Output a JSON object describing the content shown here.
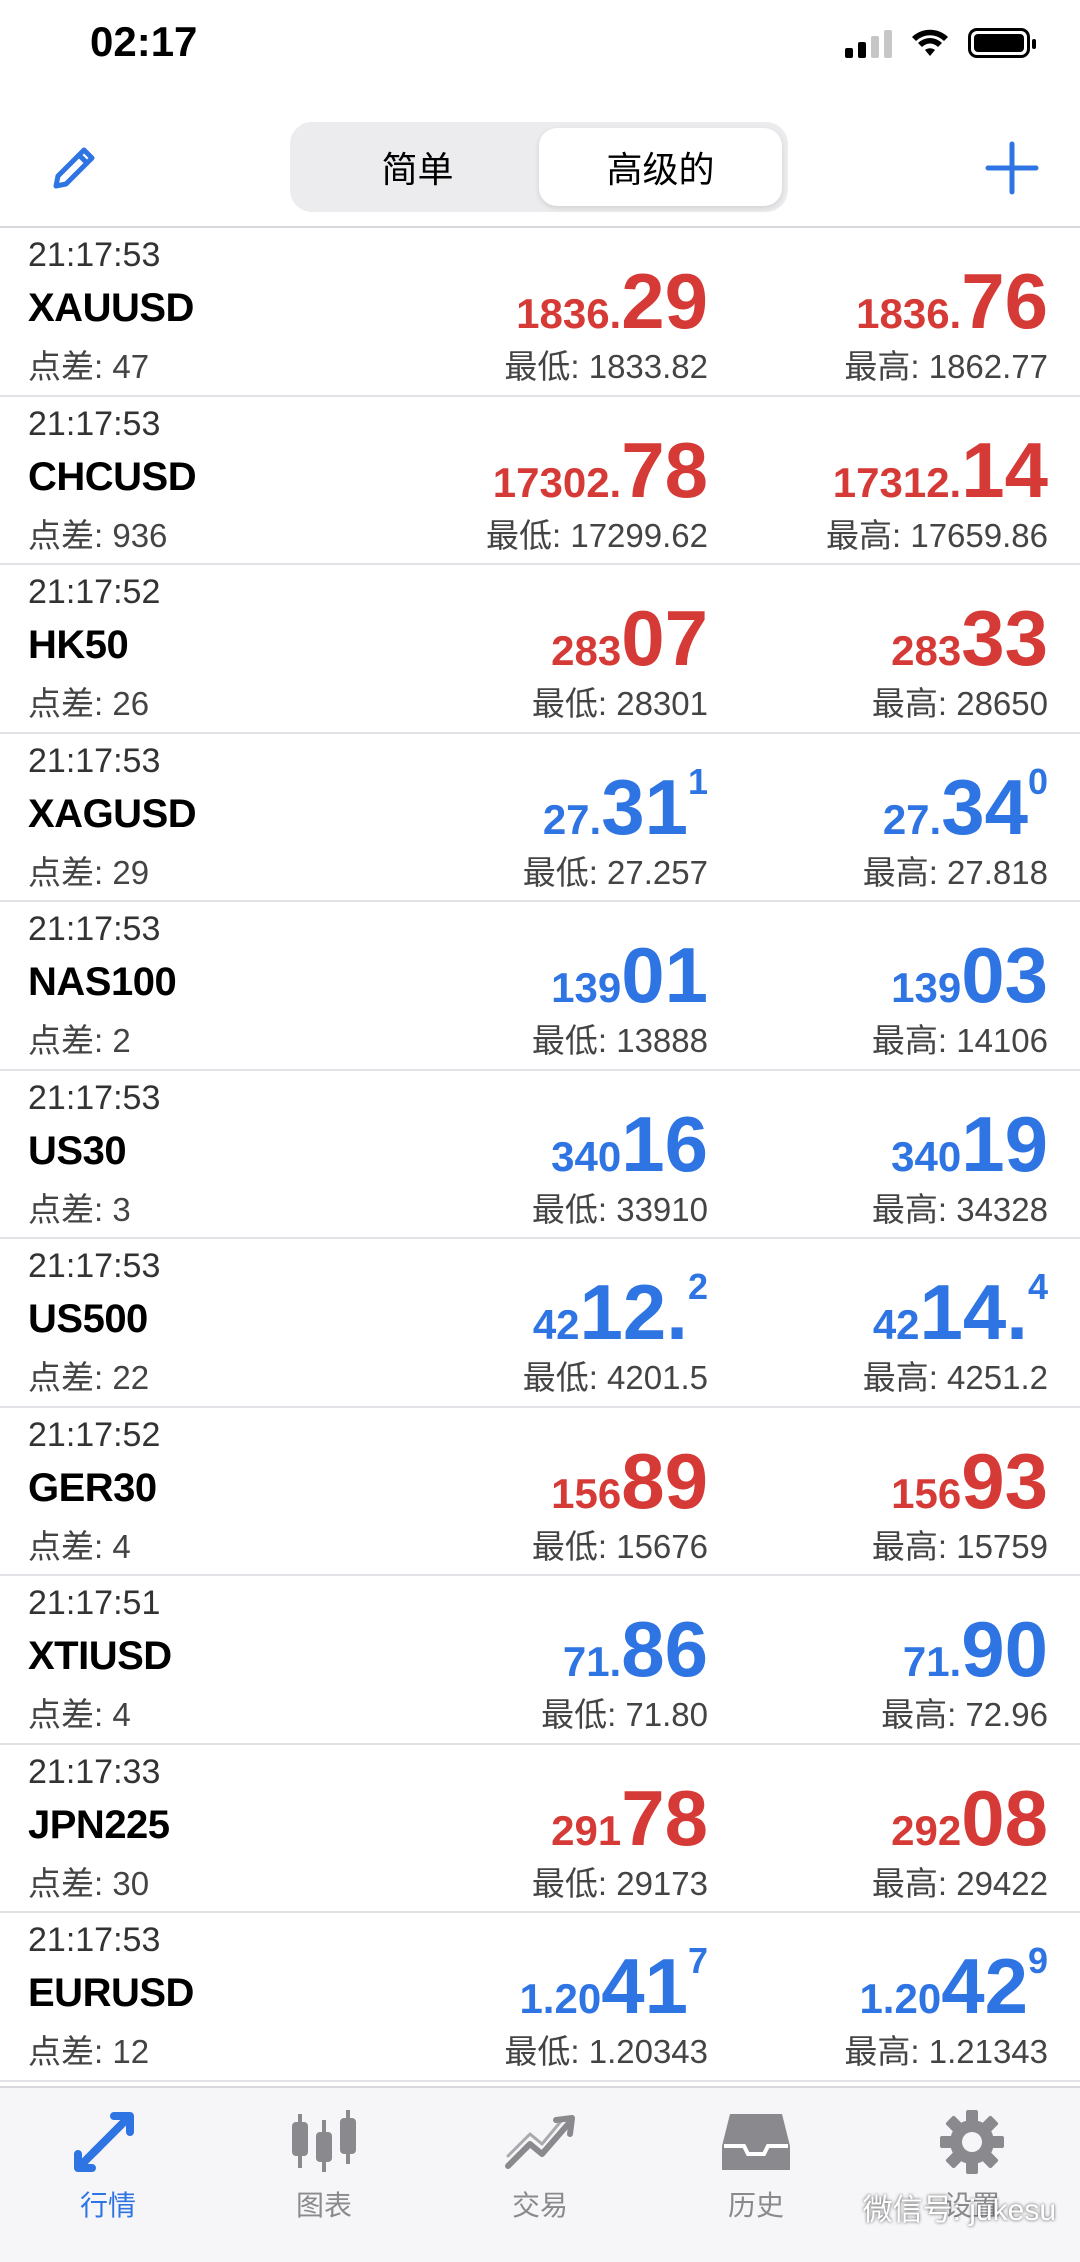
{
  "status": {
    "time": "02:17"
  },
  "header": {
    "segments": [
      {
        "label": "简单",
        "active": false
      },
      {
        "label": "高级的",
        "active": true
      }
    ]
  },
  "quotes": [
    {
      "time": "21:17:53",
      "symbol": "XAUUSD",
      "spread": "点差: 47",
      "color": "red",
      "bid": {
        "small": "1836.",
        "big": "29",
        "sup": ""
      },
      "ask": {
        "small": "1836.",
        "big": "76",
        "sup": ""
      },
      "low": "最低: 1833.82",
      "high": "最高: 1862.77"
    },
    {
      "time": "21:17:53",
      "symbol": "CHCUSD",
      "spread": "点差: 936",
      "color": "red",
      "bid": {
        "small": "17302.",
        "big": "78",
        "sup": ""
      },
      "ask": {
        "small": "17312.",
        "big": "14",
        "sup": ""
      },
      "low": "最低: 17299.62",
      "high": "最高: 17659.86"
    },
    {
      "time": "21:17:52",
      "symbol": "HK50",
      "spread": "点差: 26",
      "color": "red",
      "bid": {
        "small": "283",
        "big": "07",
        "sup": ""
      },
      "ask": {
        "small": "283",
        "big": "33",
        "sup": ""
      },
      "low": "最低: 28301",
      "high": "最高: 28650"
    },
    {
      "time": "21:17:53",
      "symbol": "XAGUSD",
      "spread": "点差: 29",
      "color": "blue",
      "bid": {
        "small": "27.",
        "big": "31",
        "sup": "1"
      },
      "ask": {
        "small": "27.",
        "big": "34",
        "sup": "0"
      },
      "low": "最低: 27.257",
      "high": "最高: 27.818"
    },
    {
      "time": "21:17:53",
      "symbol": "NAS100",
      "spread": "点差: 2",
      "color": "blue",
      "bid": {
        "small": "139",
        "big": "01",
        "sup": ""
      },
      "ask": {
        "small": "139",
        "big": "03",
        "sup": ""
      },
      "low": "最低: 13888",
      "high": "最高: 14106"
    },
    {
      "time": "21:17:53",
      "symbol": "US30",
      "spread": "点差: 3",
      "color": "blue",
      "bid": {
        "small": "340",
        "big": "16",
        "sup": ""
      },
      "ask": {
        "small": "340",
        "big": "19",
        "sup": ""
      },
      "low": "最低: 33910",
      "high": "最高: 34328"
    },
    {
      "time": "21:17:53",
      "symbol": "US500",
      "spread": "点差: 22",
      "color": "blue",
      "bid": {
        "small": "42",
        "big": "12.",
        "sup": "2"
      },
      "ask": {
        "small": "42",
        "big": "14.",
        "sup": "4"
      },
      "low": "最低: 4201.5",
      "high": "最高: 4251.2"
    },
    {
      "time": "21:17:52",
      "symbol": "GER30",
      "spread": "点差: 4",
      "color": "red",
      "bid": {
        "small": "156",
        "big": "89",
        "sup": ""
      },
      "ask": {
        "small": "156",
        "big": "93",
        "sup": ""
      },
      "low": "最低: 15676",
      "high": "最高: 15759"
    },
    {
      "time": "21:17:51",
      "symbol": "XTIUSD",
      "spread": "点差: 4",
      "color": "blue",
      "bid": {
        "small": "71.",
        "big": "86",
        "sup": ""
      },
      "ask": {
        "small": "71.",
        "big": "90",
        "sup": ""
      },
      "low": "最低: 71.80",
      "high": "最高: 72.96"
    },
    {
      "time": "21:17:33",
      "symbol": "JPN225",
      "spread": "点差: 30",
      "color": "red",
      "bid": {
        "small": "291",
        "big": "78",
        "sup": ""
      },
      "ask": {
        "small": "292",
        "big": "08",
        "sup": ""
      },
      "low": "最低: 29173",
      "high": "最高: 29422"
    },
    {
      "time": "21:17:53",
      "symbol": "EURUSD",
      "spread": "点差: 12",
      "color": "blue",
      "bid": {
        "small": "1.20",
        "big": "41",
        "sup": "7"
      },
      "ask": {
        "small": "1.20",
        "big": "42",
        "sup": "9"
      },
      "low": "最低: 1.20343",
      "high": "最高: 1.21343"
    }
  ],
  "tabs": [
    {
      "label": "行情",
      "icon": "quotes-arrows-icon",
      "active": true
    },
    {
      "label": "图表",
      "icon": "candlestick-chart-icon",
      "active": false
    },
    {
      "label": "交易",
      "icon": "trade-trend-icon",
      "active": false
    },
    {
      "label": "历史",
      "icon": "history-inbox-icon",
      "active": false
    },
    {
      "label": "设置",
      "icon": "gear-icon",
      "active": false
    }
  ],
  "watermark": "微信号: jukesu",
  "colors": {
    "red": "#d63a36",
    "blue": "#2f74e3",
    "accent": "#2f74e3"
  }
}
